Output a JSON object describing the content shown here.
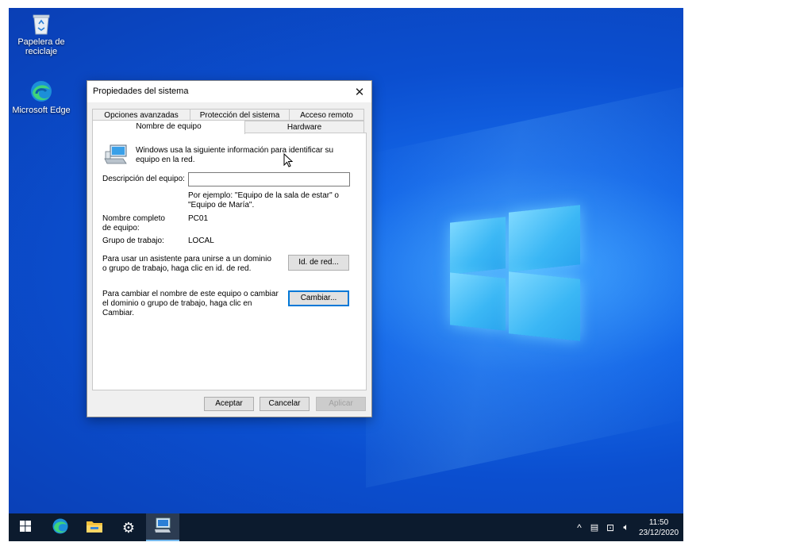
{
  "desktop": {
    "icons": [
      {
        "label": "Papelera de reciclaje",
        "icon": "recycle-bin-icon"
      },
      {
        "label": "Microsoft Edge",
        "icon": "edge-icon"
      }
    ]
  },
  "dialog": {
    "title": "Propiedades del sistema",
    "tabs": {
      "row1": [
        "Opciones avanzadas",
        "Protección del sistema",
        "Acceso remoto"
      ],
      "row2": [
        "Nombre de equipo",
        "Hardware"
      ],
      "selected": "Nombre de equipo"
    },
    "intro": "Windows usa la siguiente información para identificar su equipo en la red.",
    "description_label": "Descripción del equipo:",
    "description_value": "",
    "example": "Por ejemplo: \"Equipo de la sala de estar\" o \"Equipo de María\".",
    "fullname_label": "Nombre completo de equipo:",
    "fullname_value": "PC01",
    "workgroup_label": "Grupo de trabajo:",
    "workgroup_value": "LOCAL",
    "network_text": "Para usar un asistente para unirse a un dominio o grupo de trabajo, haga clic en id. de red.",
    "network_button": "Id. de red...",
    "change_text": "Para cambiar el nombre de este equipo o cambiar el dominio o grupo de trabajo, haga clic en Cambiar.",
    "change_button": "Cambiar...",
    "ok_button": "Aceptar",
    "cancel_button": "Cancelar",
    "apply_button": "Aplicar"
  },
  "taskbar": {
    "apps": [
      "start-icon",
      "edge-icon",
      "file-explorer-icon",
      "settings-icon",
      "system-properties-icon"
    ],
    "clock_time": "11:50",
    "clock_date": "23/12/2020"
  },
  "colors": {
    "accent": "#0078d7",
    "taskbar": "#0c1b2e",
    "desktop": "#0b4fd0"
  }
}
